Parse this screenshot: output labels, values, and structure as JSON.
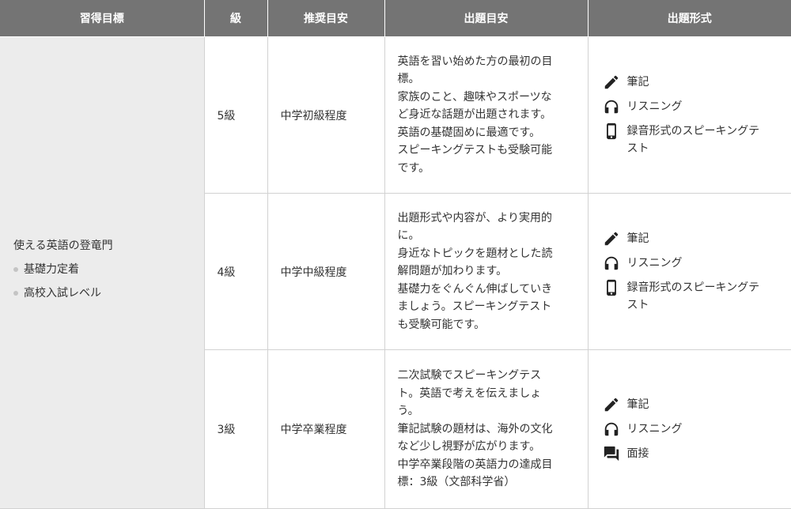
{
  "headers": [
    "習得目標",
    "級",
    "推奨目安",
    "出題目安",
    "出題形式"
  ],
  "goal": {
    "title": "使える英語の登竜門",
    "bullets": [
      "基礎力定着",
      "高校入試レベル"
    ]
  },
  "rows": [
    {
      "grade": "5級",
      "level": "中学初級程度",
      "description": [
        "英語を習い始めた方の最初の目",
        "標。",
        "家族のこと、趣味やスポーツな",
        "ど身近な話題が出題されます。",
        "英語の基礎固めに最適です。",
        "スピーキングテストも受験可能",
        "です。"
      ],
      "formats": [
        {
          "icon": "pencil-icon",
          "label": "筆記"
        },
        {
          "icon": "headphones-icon",
          "label": "リスニング"
        },
        {
          "icon": "smartphone-icon",
          "label": "録音形式のスピーキングテ",
          "label2": "スト"
        }
      ]
    },
    {
      "grade": "4級",
      "level": "中学中級程度",
      "description": [
        "出題形式や内容が、より実用的",
        "に。",
        "身近なトピックを題材とした読",
        "解問題が加わります。",
        "基礎力をぐんぐん伸ばしていき",
        "ましょう。スピーキングテスト",
        "も受験可能です。"
      ],
      "formats": [
        {
          "icon": "pencil-icon",
          "label": "筆記"
        },
        {
          "icon": "headphones-icon",
          "label": "リスニング"
        },
        {
          "icon": "smartphone-icon",
          "label": "録音形式のスピーキングテ",
          "label2": "スト"
        }
      ]
    },
    {
      "grade": "3級",
      "level": "中学卒業程度",
      "description": [
        "二次試験でスピーキングテス",
        "ト。英語で考えを伝えましょ",
        "う。",
        "筆記試験の題材は、海外の文化",
        "など少し視野が広がります。",
        "中学卒業段階の英語力の達成目",
        "標：3級（文部科学省）"
      ],
      "formats": [
        {
          "icon": "pencil-icon",
          "label": "筆記"
        },
        {
          "icon": "headphones-icon",
          "label": "リスニング"
        },
        {
          "icon": "interview-icon",
          "label": "面接"
        }
      ]
    }
  ],
  "colors": {
    "header_bg": "#747474",
    "goal_bg": "#ececec",
    "border": "#d2d2d2",
    "text": "#333333"
  }
}
